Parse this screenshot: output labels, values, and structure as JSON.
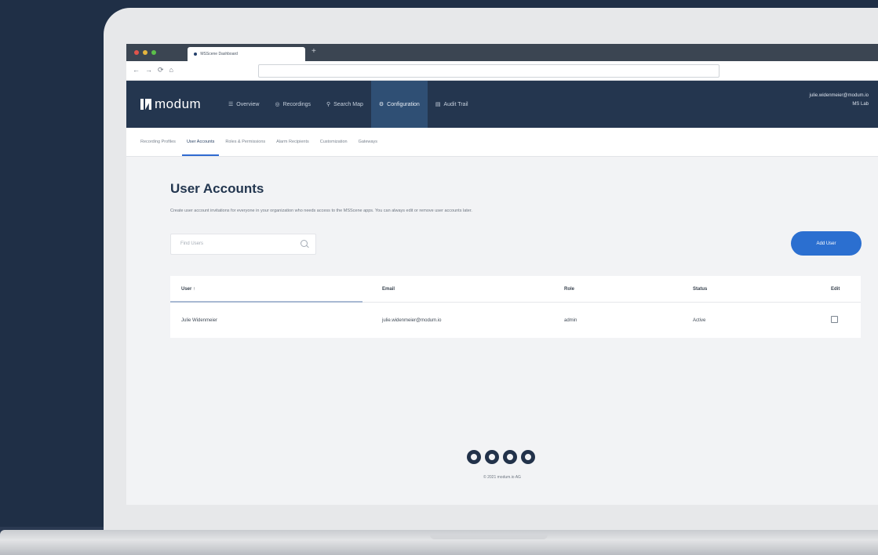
{
  "browser": {
    "tab_title": "MSScene Dashboard",
    "new_tab": "+",
    "nav": {
      "back": "←",
      "forward": "→",
      "reload": "⟳",
      "home": "⌂"
    }
  },
  "app": {
    "logo": "modum",
    "nav": [
      {
        "icon": "list-icon",
        "label": "Overview"
      },
      {
        "icon": "record-icon",
        "label": "Recordings"
      },
      {
        "icon": "map-pin-icon",
        "label": "Search Map"
      },
      {
        "icon": "settings-icon",
        "label": "Configuration",
        "active": true
      },
      {
        "icon": "document-icon",
        "label": "Audit Trail"
      }
    ],
    "user": {
      "email": "julie.widenmeier@modum.io",
      "role": "MS Lab"
    }
  },
  "subnav": [
    {
      "label": "Recording Profiles"
    },
    {
      "label": "User Accounts",
      "active": true
    },
    {
      "label": "Roles & Permissions"
    },
    {
      "label": "Alarm Recipients"
    },
    {
      "label": "Customization"
    },
    {
      "label": "Gateways"
    }
  ],
  "page": {
    "title": "User Accounts",
    "description": "Create user account invitations for everyone in your organization who needs access to the MSScene apps. You can always edit or remove user accounts later.",
    "search_placeholder": "Find Users",
    "add_button": "Add User"
  },
  "table": {
    "headers": [
      "User ↑",
      "Email",
      "Role",
      "Status",
      "Edit"
    ],
    "rows": [
      {
        "user": "Julie Widenmeier",
        "email": "julie.widenmeier@modum.io",
        "role": "admin",
        "status": "Active"
      }
    ]
  },
  "footer": {
    "copyright": "© 2021 modum.io AG"
  },
  "colors": {
    "background": "#1f2f46",
    "nav": "#24364f",
    "nav_active": "#2f4f74",
    "accent": "#2b6fd0"
  }
}
